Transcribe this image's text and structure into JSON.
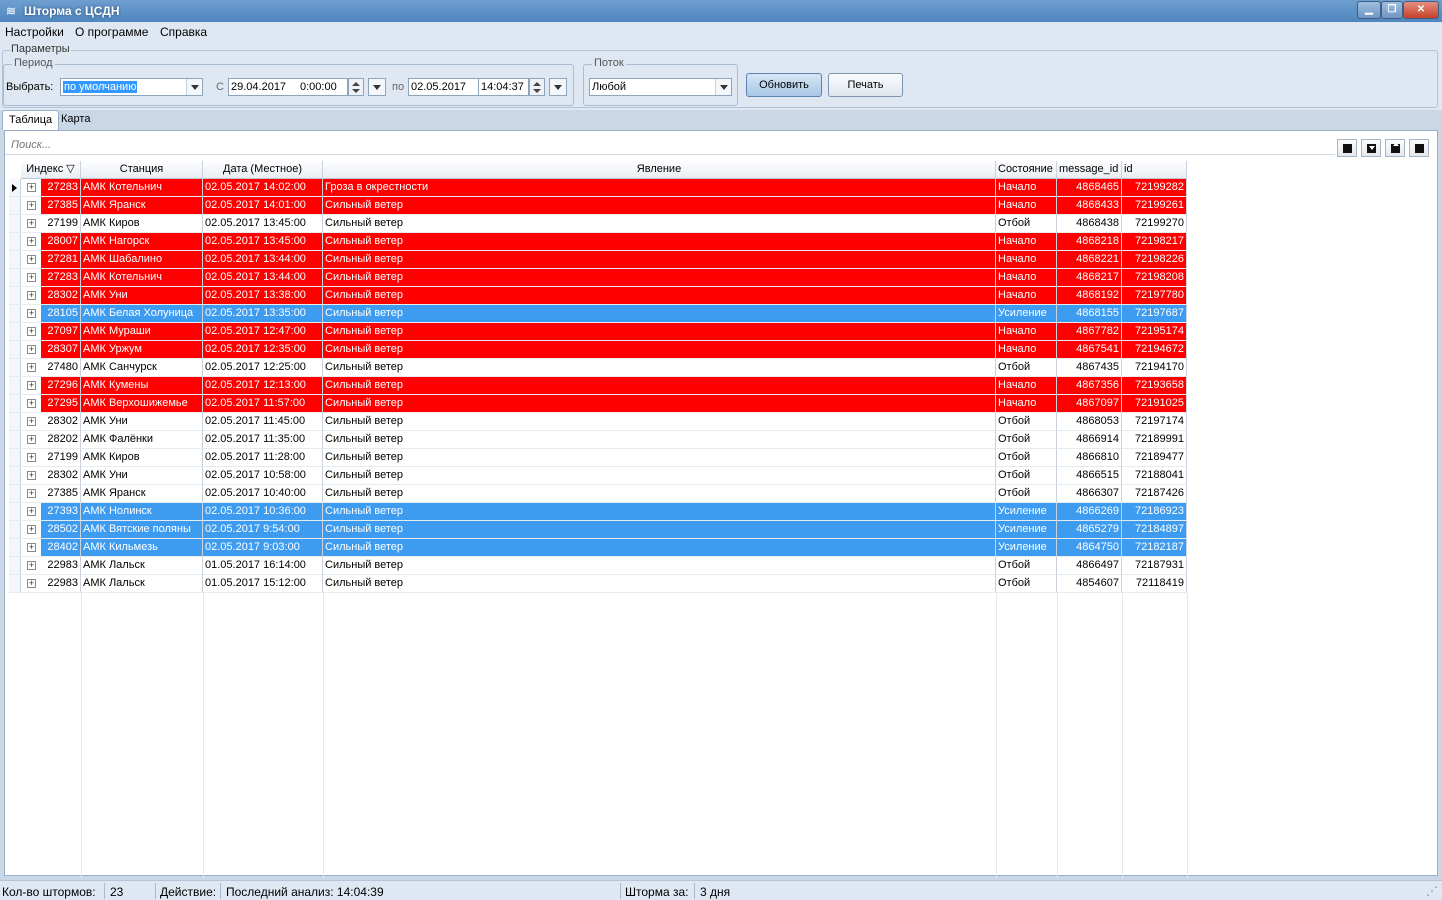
{
  "window": {
    "title": "Шторма с ЦСДН"
  },
  "menu": [
    "Настройки",
    "О программе",
    "Справка"
  ],
  "params": {
    "legend": "Параметры",
    "period": {
      "legend": "Период",
      "select_label": "Выбрать:",
      "select_value": "по умолчанию",
      "from_label": "С",
      "from_date": "29.04.2017",
      "from_time": "0:00:00",
      "to_label": "по",
      "to_date": "02.05.2017",
      "to_time": "14:04:37"
    },
    "stream": {
      "legend": "Поток",
      "value": "Любой"
    },
    "refresh_button": "Обновить",
    "print_button": "Печать"
  },
  "tabs": [
    {
      "label": "Таблица",
      "active": true
    },
    {
      "label": "Карта",
      "active": false
    }
  ],
  "search": {
    "placeholder": "Поиск..."
  },
  "table": {
    "columns": [
      "Индекс ▽",
      "Станция",
      "Дата (Местное)",
      "Явление",
      "Состояние",
      "message_id",
      "id"
    ],
    "rows": [
      {
        "status": "red",
        "cells": [
          "27283",
          "АМК Котельнич",
          "02.05.2017 14:02:00",
          "Гроза в окрестности",
          "Начало",
          "4868465",
          "72199282"
        ]
      },
      {
        "status": "red",
        "cells": [
          "27385",
          "АМК Яранск",
          "02.05.2017 14:01:00",
          "Сильный ветер",
          "Начало",
          "4868433",
          "72199261"
        ]
      },
      {
        "status": "none",
        "cells": [
          "27199",
          "АМК Киров",
          "02.05.2017 13:45:00",
          "Сильный ветер",
          "Отбой",
          "4868438",
          "72199270"
        ]
      },
      {
        "status": "red",
        "cells": [
          "28007",
          "АМК Нагорск",
          "02.05.2017 13:45:00",
          "Сильный ветер",
          "Начало",
          "4868218",
          "72198217"
        ]
      },
      {
        "status": "red",
        "cells": [
          "27281",
          "АМК Шабалино",
          "02.05.2017 13:44:00",
          "Сильный ветер",
          "Начало",
          "4868221",
          "72198226"
        ]
      },
      {
        "status": "red",
        "cells": [
          "27283",
          "АМК Котельнич",
          "02.05.2017 13:44:00",
          "Сильный ветер",
          "Начало",
          "4868217",
          "72198208"
        ]
      },
      {
        "status": "red",
        "cells": [
          "28302",
          "АМК Уни",
          "02.05.2017 13:38:00",
          "Сильный ветер",
          "Начало",
          "4868192",
          "72197780"
        ]
      },
      {
        "status": "blue",
        "cells": [
          "28105",
          "АМК Белая Холуница",
          "02.05.2017 13:35:00",
          "Сильный ветер",
          "Усиление",
          "4868155",
          "72197687"
        ]
      },
      {
        "status": "red",
        "cells": [
          "27097",
          "АМК Мураши",
          "02.05.2017 12:47:00",
          "Сильный ветер",
          "Начало",
          "4867782",
          "72195174"
        ]
      },
      {
        "status": "red",
        "cells": [
          "28307",
          "АМК Уржум",
          "02.05.2017 12:35:00",
          "Сильный ветер",
          "Начало",
          "4867541",
          "72194672"
        ]
      },
      {
        "status": "none",
        "cells": [
          "27480",
          "АМК Санчурск",
          "02.05.2017 12:25:00",
          "Сильный ветер",
          "Отбой",
          "4867435",
          "72194170"
        ]
      },
      {
        "status": "red",
        "cells": [
          "27296",
          "АМК Кумены",
          "02.05.2017 12:13:00",
          "Сильный ветер",
          "Начало",
          "4867356",
          "72193658"
        ]
      },
      {
        "status": "red",
        "cells": [
          "27295",
          "АМК Верхошижемье",
          "02.05.2017 11:57:00",
          "Сильный ветер",
          "Начало",
          "4867097",
          "72191025"
        ]
      },
      {
        "status": "none",
        "cells": [
          "28302",
          "АМК Уни",
          "02.05.2017 11:45:00",
          "Сильный ветер",
          "Отбой",
          "4868053",
          "72197174"
        ]
      },
      {
        "status": "none",
        "cells": [
          "28202",
          "АМК Фалёнки",
          "02.05.2017 11:35:00",
          "Сильный ветер",
          "Отбой",
          "4866914",
          "72189991"
        ]
      },
      {
        "status": "none",
        "cells": [
          "27199",
          "АМК Киров",
          "02.05.2017 11:28:00",
          "Сильный ветер",
          "Отбой",
          "4866810",
          "72189477"
        ]
      },
      {
        "status": "none",
        "cells": [
          "28302",
          "АМК Уни",
          "02.05.2017 10:58:00",
          "Сильный ветер",
          "Отбой",
          "4866515",
          "72188041"
        ]
      },
      {
        "status": "none",
        "cells": [
          "27385",
          "АМК Яранск",
          "02.05.2017 10:40:00",
          "Сильный ветер",
          "Отбой",
          "4866307",
          "72187426"
        ]
      },
      {
        "status": "blue",
        "cells": [
          "27393",
          "АМК Нолинск",
          "02.05.2017 10:36:00",
          "Сильный ветер",
          "Усиление",
          "4866269",
          "72186923"
        ]
      },
      {
        "status": "blue",
        "cells": [
          "28502",
          "АМК Вятские поляны",
          "02.05.2017 9:54:00",
          "Сильный ветер",
          "Усиление",
          "4865279",
          "72184897"
        ]
      },
      {
        "status": "blue",
        "cells": [
          "28402",
          "АМК Кильмезь",
          "02.05.2017 9:03:00",
          "Сильный ветер",
          "Усиление",
          "4864750",
          "72182187"
        ]
      },
      {
        "status": "none",
        "cells": [
          "22983",
          "АМК Лальск",
          "01.05.2017 16:14:00",
          "Сильный ветер",
          "Отбой",
          "4866497",
          "72187931"
        ]
      },
      {
        "status": "none",
        "cells": [
          "22983",
          "АМК Лальск",
          "01.05.2017 15:12:00",
          "Сильный ветер",
          "Отбой",
          "4854607",
          "72118419"
        ]
      }
    ]
  },
  "status": {
    "count_label": "Кол-во штормов:",
    "count_value": "23",
    "action_label": "Действие:",
    "last_analysis": "Последний анализ: 14:04:39",
    "period_label": "Шторма за:",
    "period_value": "3 дня"
  },
  "colors": {
    "red_row": "#ff0000",
    "blue_row": "#3d9bf0"
  }
}
